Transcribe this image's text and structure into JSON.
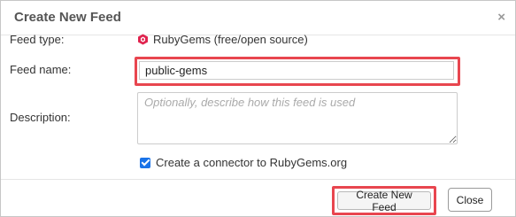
{
  "dialog": {
    "title": "Create New Feed",
    "close_glyph": "×"
  },
  "form": {
    "feed_type_label": "Feed type:",
    "feed_type_value": "RubyGems (free/open source)",
    "feed_type_icon": "rubygems-icon",
    "feed_name_label": "Feed name:",
    "feed_name_value": "public-gems",
    "description_label": "Description:",
    "description_placeholder": "Optionally, describe how this feed is used",
    "connector_label": "Create a connector to RubyGems.org",
    "connector_checked": true
  },
  "buttons": {
    "create_label": "Create New Feed",
    "close_label": "Close"
  },
  "colors": {
    "highlight": "#e8464f",
    "ruby": "#e0234e",
    "checkbox": "#1a73e8"
  }
}
